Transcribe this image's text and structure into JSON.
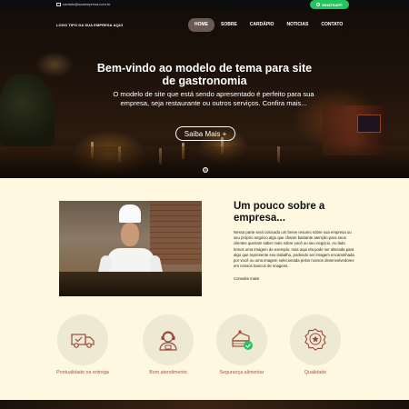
{
  "topbar": {
    "email": "contato@suaempresa.com.br",
    "whatsapp_label": "WHATSAPP"
  },
  "header": {
    "logo_text": "LOGO TIPO DA SUA EMPRESA AQUI",
    "nav": [
      {
        "label": "HOME",
        "active": true
      },
      {
        "label": "SOBRE",
        "active": false
      },
      {
        "label": "CARDÁPIO",
        "active": false
      },
      {
        "label": "NOTICIAS",
        "active": false
      },
      {
        "label": "CONTATO",
        "active": false
      }
    ]
  },
  "hero": {
    "title": "Bem-vindo ao modelo de tema para site de gastronomia",
    "subtitle": "O modelo de site que está sendo apresentado é perfeito para sua empresa, seja restaurante ou outros serviços. Confira mais...",
    "cta_label": "Saiba Mais +"
  },
  "about": {
    "title": "Um pouco sobre a empresa...",
    "text": "Nessa parte será colocado um breve resumo sobre sua empresa ou seu próprio negócio algo que chame bastante atenção para seus clientes queiram saber mais sobre você ou seu negócio. Ao lado temos uma imagem de exemplo, mas aqui ela pode ser alterada para algo que represente seu trabalho, podendo ser imagem encaminhada por você ou uma imagem selecionada pelos nossos desenvolvedores em nossos bancos de imagens.",
    "link": "Consulte mais!"
  },
  "features": [
    {
      "label": "Pontualidade na entrega",
      "icon": "delivery-truck-icon"
    },
    {
      "label": "Bom atendimento",
      "icon": "attendant-icon"
    },
    {
      "label": "Segurança alimentar",
      "icon": "safe-food-icon"
    },
    {
      "label": "Qualidade",
      "icon": "quality-badge-icon"
    }
  ],
  "colors": {
    "accent_green": "#22c55e",
    "about_bg": "#fdf8df",
    "feature_label": "#a0574a",
    "icon_stroke": "#9a4a3c"
  }
}
